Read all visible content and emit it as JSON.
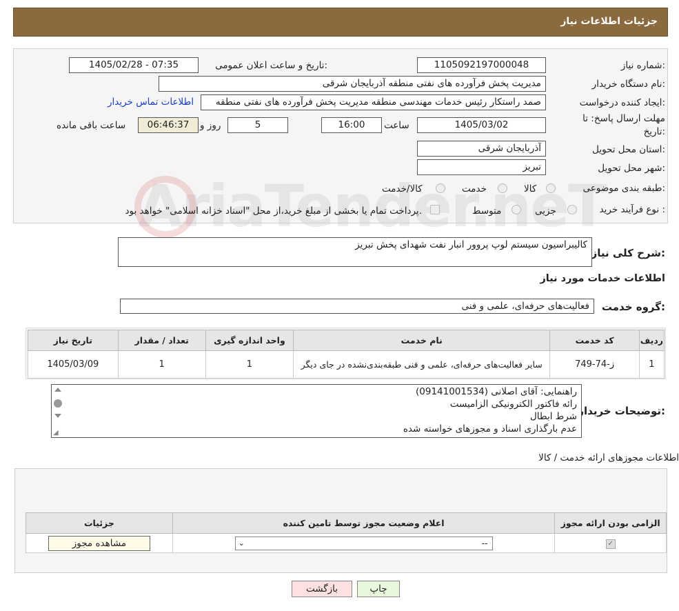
{
  "header": {
    "title": "جزئیات اطلاعات نیاز"
  },
  "fields": {
    "need_number_label": "شماره نیاز:",
    "need_number": "1105092197000048",
    "announce_label": "تاریخ و ساعت اعلان عمومی:",
    "announce_value": "1405/02/28 - 07:35",
    "buyer_org_label": "نام دستگاه خریدار:",
    "buyer_org": "مدیریت پخش فرآورده های نفتی منطقه آذربایجان شرقی",
    "creator_label": "ایجاد کننده درخواست:",
    "creator": "صمد راستکار رئیس خدمات مهندسی منطقه مدیریت پخش فرآورده های نفتی منطقه",
    "contact_link": "اطلاعات تماس خریدار",
    "deadline_label_1": "مهلت ارسال پاسخ: تا",
    "deadline_label_2": "تاریخ:",
    "deadline_date": "1405/03/02",
    "time_label": "ساعت",
    "deadline_time": "16:00",
    "days": "5",
    "days_label": "روز و",
    "remaining": "06:46:37",
    "remaining_label": "ساعت باقی مانده",
    "province_label": "استان محل تحویل:",
    "province": "آذربایجان شرقی",
    "city_label": "شهر محل تحویل:",
    "city": "تبریز",
    "category_label": "طبقه بندی موضوعی:",
    "category_options": [
      "کالا",
      "خدمت",
      "کالا/خدمت"
    ],
    "process_label": "نوع فرآیند خرید :",
    "process_options": [
      "جزیی",
      "متوسط"
    ],
    "process_note": "پرداخت تمام یا بخشی از مبلغ خرید،از محل \"اسناد خزانه اسلامی\" خواهد بود."
  },
  "watermark": "AriaTender.neT",
  "summary": {
    "label": "شرح کلی نیاز:",
    "value": "کالیبراسیون سیستم لوپ پروور انبار نفت شهدای پخش تبریز"
  },
  "services": {
    "section_title": "اطلاعات خدمات مورد نیاز",
    "group_label": "گروه خدمت:",
    "group_value": "فعالیت‌های حرفه‌ای، علمی و فنی",
    "columns": [
      "ردیف",
      "کد خدمت",
      "نام خدمت",
      "واحد اندازه گیری",
      "تعداد / مقدار",
      "تاریخ نیاز"
    ],
    "rows": [
      {
        "index": "1",
        "code": "ز-74-749",
        "name": "سایر فعالیت‌های حرفه‌ای، علمی و فنی طبقه‌بندی‌نشده در جای دیگر",
        "unit": "1",
        "qty": "1",
        "date": "1405/03/09"
      }
    ]
  },
  "buyer_notes": {
    "label": "توضیحات خریدار:",
    "lines": [
      "راهنمایی: آقای اصلانی (09141001534)",
      "رائه فاکتور الکترونیکی الزامیست",
      "شرط ابطال",
      "عدم بارگذاری اسناد و مجوزهای خواسته شده"
    ]
  },
  "permits": {
    "section_title": "اطلاعات مجوزهای ارائه خدمت / کالا",
    "columns": [
      "الزامی بودن ارائه مجوز",
      "اعلام وضعیت مجوز توسط تامین کننده",
      "جزئیات"
    ],
    "select_value": "--",
    "view_button": "مشاهده مجوز"
  },
  "buttons": {
    "print": "چاپ",
    "back": "بازگشت"
  },
  "colors": {
    "header_bg": "#8b6a3f",
    "link": "#1a3fbf",
    "back_bg": "#fde0e0",
    "print_bg": "#e8f8dc"
  }
}
